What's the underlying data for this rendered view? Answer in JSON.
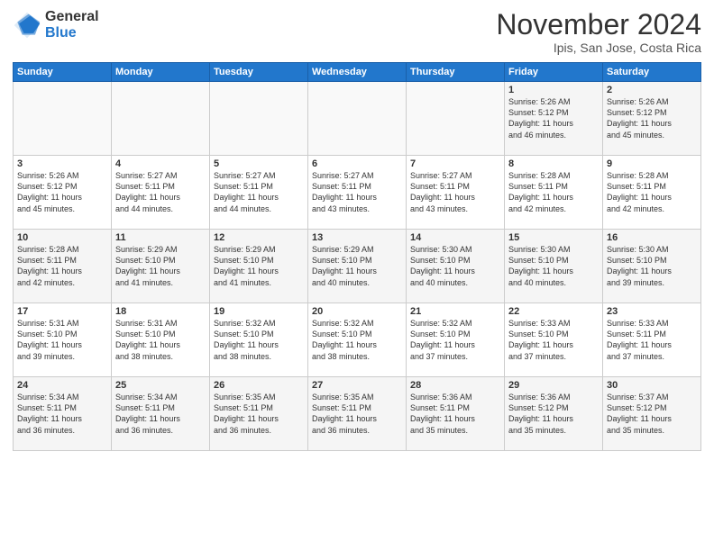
{
  "logo": {
    "general": "General",
    "blue": "Blue"
  },
  "header": {
    "month": "November 2024",
    "location": "Ipis, San Jose, Costa Rica"
  },
  "days_of_week": [
    "Sunday",
    "Monday",
    "Tuesday",
    "Wednesday",
    "Thursday",
    "Friday",
    "Saturday"
  ],
  "weeks": [
    [
      {
        "num": "",
        "info": ""
      },
      {
        "num": "",
        "info": ""
      },
      {
        "num": "",
        "info": ""
      },
      {
        "num": "",
        "info": ""
      },
      {
        "num": "",
        "info": ""
      },
      {
        "num": "1",
        "info": "Sunrise: 5:26 AM\nSunset: 5:12 PM\nDaylight: 11 hours\nand 46 minutes."
      },
      {
        "num": "2",
        "info": "Sunrise: 5:26 AM\nSunset: 5:12 PM\nDaylight: 11 hours\nand 45 minutes."
      }
    ],
    [
      {
        "num": "3",
        "info": "Sunrise: 5:26 AM\nSunset: 5:12 PM\nDaylight: 11 hours\nand 45 minutes."
      },
      {
        "num": "4",
        "info": "Sunrise: 5:27 AM\nSunset: 5:11 PM\nDaylight: 11 hours\nand 44 minutes."
      },
      {
        "num": "5",
        "info": "Sunrise: 5:27 AM\nSunset: 5:11 PM\nDaylight: 11 hours\nand 44 minutes."
      },
      {
        "num": "6",
        "info": "Sunrise: 5:27 AM\nSunset: 5:11 PM\nDaylight: 11 hours\nand 43 minutes."
      },
      {
        "num": "7",
        "info": "Sunrise: 5:27 AM\nSunset: 5:11 PM\nDaylight: 11 hours\nand 43 minutes."
      },
      {
        "num": "8",
        "info": "Sunrise: 5:28 AM\nSunset: 5:11 PM\nDaylight: 11 hours\nand 42 minutes."
      },
      {
        "num": "9",
        "info": "Sunrise: 5:28 AM\nSunset: 5:11 PM\nDaylight: 11 hours\nand 42 minutes."
      }
    ],
    [
      {
        "num": "10",
        "info": "Sunrise: 5:28 AM\nSunset: 5:11 PM\nDaylight: 11 hours\nand 42 minutes."
      },
      {
        "num": "11",
        "info": "Sunrise: 5:29 AM\nSunset: 5:10 PM\nDaylight: 11 hours\nand 41 minutes."
      },
      {
        "num": "12",
        "info": "Sunrise: 5:29 AM\nSunset: 5:10 PM\nDaylight: 11 hours\nand 41 minutes."
      },
      {
        "num": "13",
        "info": "Sunrise: 5:29 AM\nSunset: 5:10 PM\nDaylight: 11 hours\nand 40 minutes."
      },
      {
        "num": "14",
        "info": "Sunrise: 5:30 AM\nSunset: 5:10 PM\nDaylight: 11 hours\nand 40 minutes."
      },
      {
        "num": "15",
        "info": "Sunrise: 5:30 AM\nSunset: 5:10 PM\nDaylight: 11 hours\nand 40 minutes."
      },
      {
        "num": "16",
        "info": "Sunrise: 5:30 AM\nSunset: 5:10 PM\nDaylight: 11 hours\nand 39 minutes."
      }
    ],
    [
      {
        "num": "17",
        "info": "Sunrise: 5:31 AM\nSunset: 5:10 PM\nDaylight: 11 hours\nand 39 minutes."
      },
      {
        "num": "18",
        "info": "Sunrise: 5:31 AM\nSunset: 5:10 PM\nDaylight: 11 hours\nand 38 minutes."
      },
      {
        "num": "19",
        "info": "Sunrise: 5:32 AM\nSunset: 5:10 PM\nDaylight: 11 hours\nand 38 minutes."
      },
      {
        "num": "20",
        "info": "Sunrise: 5:32 AM\nSunset: 5:10 PM\nDaylight: 11 hours\nand 38 minutes."
      },
      {
        "num": "21",
        "info": "Sunrise: 5:32 AM\nSunset: 5:10 PM\nDaylight: 11 hours\nand 37 minutes."
      },
      {
        "num": "22",
        "info": "Sunrise: 5:33 AM\nSunset: 5:10 PM\nDaylight: 11 hours\nand 37 minutes."
      },
      {
        "num": "23",
        "info": "Sunrise: 5:33 AM\nSunset: 5:11 PM\nDaylight: 11 hours\nand 37 minutes."
      }
    ],
    [
      {
        "num": "24",
        "info": "Sunrise: 5:34 AM\nSunset: 5:11 PM\nDaylight: 11 hours\nand 36 minutes."
      },
      {
        "num": "25",
        "info": "Sunrise: 5:34 AM\nSunset: 5:11 PM\nDaylight: 11 hours\nand 36 minutes."
      },
      {
        "num": "26",
        "info": "Sunrise: 5:35 AM\nSunset: 5:11 PM\nDaylight: 11 hours\nand 36 minutes."
      },
      {
        "num": "27",
        "info": "Sunrise: 5:35 AM\nSunset: 5:11 PM\nDaylight: 11 hours\nand 36 minutes."
      },
      {
        "num": "28",
        "info": "Sunrise: 5:36 AM\nSunset: 5:11 PM\nDaylight: 11 hours\nand 35 minutes."
      },
      {
        "num": "29",
        "info": "Sunrise: 5:36 AM\nSunset: 5:12 PM\nDaylight: 11 hours\nand 35 minutes."
      },
      {
        "num": "30",
        "info": "Sunrise: 5:37 AM\nSunset: 5:12 PM\nDaylight: 11 hours\nand 35 minutes."
      }
    ]
  ]
}
